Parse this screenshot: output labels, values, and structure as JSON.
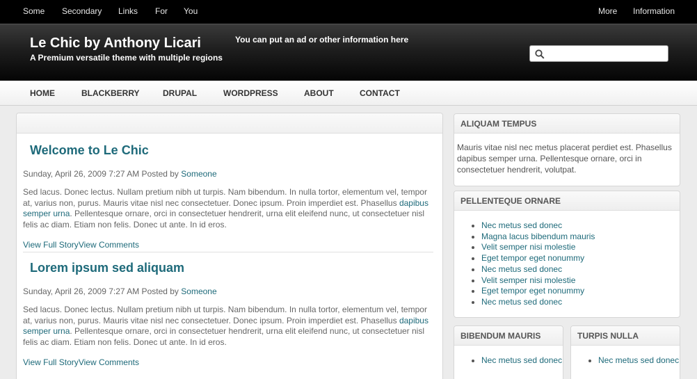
{
  "topbar": {
    "left_links": [
      "Some",
      "Secondary",
      "Links",
      "For",
      "You"
    ],
    "right_links": [
      "More",
      "Information"
    ]
  },
  "header": {
    "site_title": "Le Chic by Anthony Licari",
    "slogan": "A Premium versatile theme with multiple regions",
    "ad_text": "You can put an ad or other information here",
    "search": {
      "placeholder": "",
      "icon": "search-icon"
    }
  },
  "nav": {
    "items": [
      "HOME",
      "BLACKBERRY",
      "DRUPAL",
      "WORDPRESS",
      "ABOUT",
      "CONTACT"
    ]
  },
  "posts": [
    {
      "title": "Welcome to Le Chic",
      "meta_prefix": "Sunday, April 26, 2009 7:27 AM Posted by ",
      "author": "Someone",
      "body_start": "Sed lacus. Donec lectus. Nullam pretium nibh ut turpis. Nam bibendum. In nulla tortor, elementum vel, tempor at, varius non, purus. Mauris vitae nisl nec consectetuer. Donec ipsum. Proin imperdiet est. Phasellus ",
      "body_link": "dapibus semper urna",
      "body_end": ". Pellentesque ornare, orci in consectetuer hendrerit, urna elit eleifend nunc, ut consectetuer nisl felis ac diam. Etiam non felis. Donec ut ante. In id eros.",
      "link_full_story": "View Full Story",
      "link_comments": "View Comments"
    },
    {
      "title": "Lorem ipsum sed aliquam",
      "meta_prefix": "Sunday, April 26, 2009 7:27 AM Posted by ",
      "author": "Someone",
      "body_start": "Sed lacus. Donec lectus. Nullam pretium nibh ut turpis. Nam bibendum. In nulla tortor, elementum vel, tempor at, varius non, purus. Mauris vitae nisl nec consectetuer. Donec ipsum. Proin imperdiet est. Phasellus ",
      "body_link": "dapibus semper urna",
      "body_end": ". Pellentesque ornare, orci in consectetuer hendrerit, urna elit eleifend nunc, ut consectetuer nisl felis ac diam. Etiam non felis. Donec ut ante. In id eros.",
      "link_full_story": "View Full Story",
      "link_comments": "View Comments"
    }
  ],
  "sidebar": {
    "aliquam": {
      "title": "ALIQUAM TEMPUS",
      "text": "Mauris vitae nisl nec metus placerat perdiet est. Phasellus dapibus semper urna. Pellentesque ornare, orci in consectetuer hendrerit, volutpat."
    },
    "pellenteque": {
      "title": "PELLENTEQUE ORNARE",
      "items": [
        "Nec metus sed donec",
        "Magna lacus bibendum mauris",
        "Velit semper nisi molestie",
        "Eget tempor eget nonummy",
        "Nec metus sed donec",
        "Velit semper nisi molestie",
        "Eget tempor eget nonummy",
        "Nec metus sed donec"
      ]
    },
    "bibendum": {
      "title": "BIBENDUM MAURIS",
      "items": [
        "Nec metus sed donec"
      ]
    },
    "turpis": {
      "title": "TURPIS NULLA",
      "items": [
        "Nec metus sed donec"
      ]
    }
  },
  "colors": {
    "link": "#1e6a7a",
    "topbar_bg": "#000000",
    "page_bg": "#ececec"
  }
}
